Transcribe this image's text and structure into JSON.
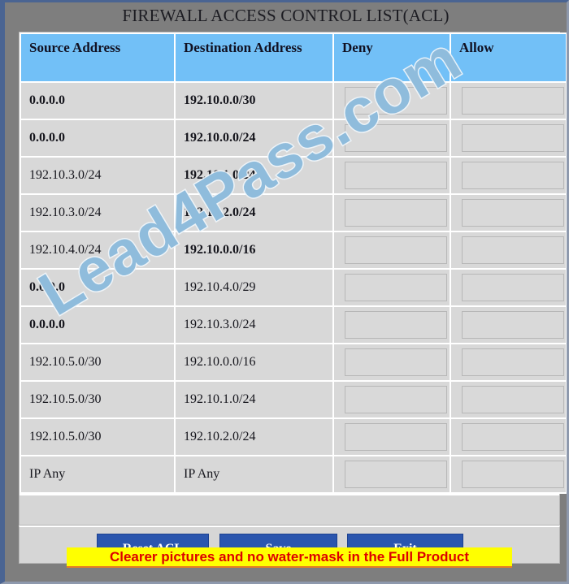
{
  "window": {
    "title": "FIREWALL ACCESS CONTROL LIST(ACL)"
  },
  "table": {
    "columns": [
      {
        "key": "source",
        "label": "Source Address"
      },
      {
        "key": "destination",
        "label": "Destination Address"
      },
      {
        "key": "deny",
        "label": "Deny"
      },
      {
        "key": "allow",
        "label": "Allow"
      }
    ],
    "rows": [
      {
        "source": "0.0.0.0",
        "source_bold": true,
        "destination": "192.10.0.0/30",
        "destination_bold": true,
        "deny": "",
        "allow": ""
      },
      {
        "source": "0.0.0.0",
        "source_bold": true,
        "destination": "192.10.0.0/24",
        "destination_bold": true,
        "deny": "",
        "allow": ""
      },
      {
        "source": "192.10.3.0/24",
        "source_bold": false,
        "destination": "192.10.1.0/24",
        "destination_bold": true,
        "deny": "",
        "allow": ""
      },
      {
        "source": "192.10.3.0/24",
        "source_bold": false,
        "destination": "192.10.2.0/24",
        "destination_bold": true,
        "deny": "",
        "allow": ""
      },
      {
        "source": "192.10.4.0/24",
        "source_bold": false,
        "destination": "192.10.0.0/16",
        "destination_bold": true,
        "deny": "",
        "allow": ""
      },
      {
        "source": "0.0.0.0",
        "source_bold": true,
        "destination": "192.10.4.0/29",
        "destination_bold": false,
        "deny": "",
        "allow": ""
      },
      {
        "source": "0.0.0.0",
        "source_bold": true,
        "destination": "192.10.3.0/24",
        "destination_bold": false,
        "deny": "",
        "allow": ""
      },
      {
        "source": "192.10.5.0/30",
        "source_bold": false,
        "destination": "192.10.0.0/16",
        "destination_bold": false,
        "deny": "",
        "allow": ""
      },
      {
        "source": "192.10.5.0/30",
        "source_bold": false,
        "destination": "192.10.1.0/24",
        "destination_bold": false,
        "deny": "",
        "allow": ""
      },
      {
        "source": "192.10.5.0/30",
        "source_bold": false,
        "destination": "192.10.2.0/24",
        "destination_bold": false,
        "deny": "",
        "allow": ""
      },
      {
        "source": "IP Any",
        "source_bold": false,
        "destination": "IP Any",
        "destination_bold": false,
        "deny": "",
        "allow": ""
      }
    ]
  },
  "buttons": {
    "reset": "Reset ACL",
    "save": "Save",
    "exit": "Exit"
  },
  "watermark": {
    "text": "Lead4Pass.com"
  },
  "promo": {
    "text": "Clearer pictures and no water-mask in the Full Product"
  },
  "colors": {
    "header_blue": "#72c0f7",
    "cell_gray": "#d8d8d8",
    "frame_gray": "#7e7e7e",
    "button_blue": "#2b56ae",
    "promo_background": "#ffff00",
    "promo_text": "#dd0000",
    "watermark_blue": "#8fbcdc"
  }
}
